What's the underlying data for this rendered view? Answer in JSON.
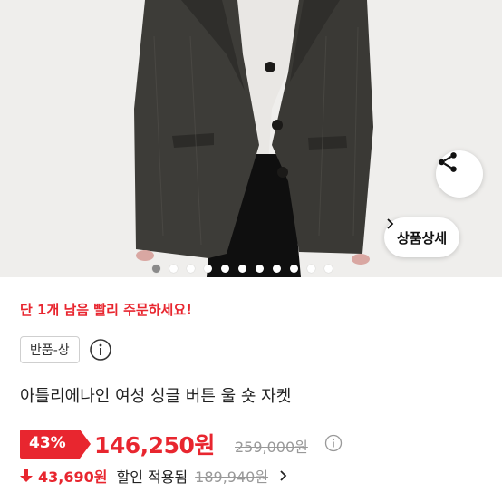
{
  "hero": {
    "image_desc": "dark grey tweed single-button wool jacket",
    "dot_count": 12,
    "active_dot": 0
  },
  "actions": {
    "share_icon": "share-icon",
    "detail_label": "상품상세"
  },
  "product": {
    "stock_alert": "단 1개 남음 빨리 주문하세요!",
    "return_badge": "반품-상",
    "name": "아틀리에나인 여성 싱글 버튼 울 숏 자켓",
    "discount_rate": "43%",
    "sale_price": "146,250원",
    "original_price": "259,000원",
    "coupon": {
      "amount": "43,690원",
      "text": "할인 적용됨",
      "price": "189,940원"
    }
  },
  "colors": {
    "accent_red": "#e8262f",
    "muted": "#999999"
  }
}
